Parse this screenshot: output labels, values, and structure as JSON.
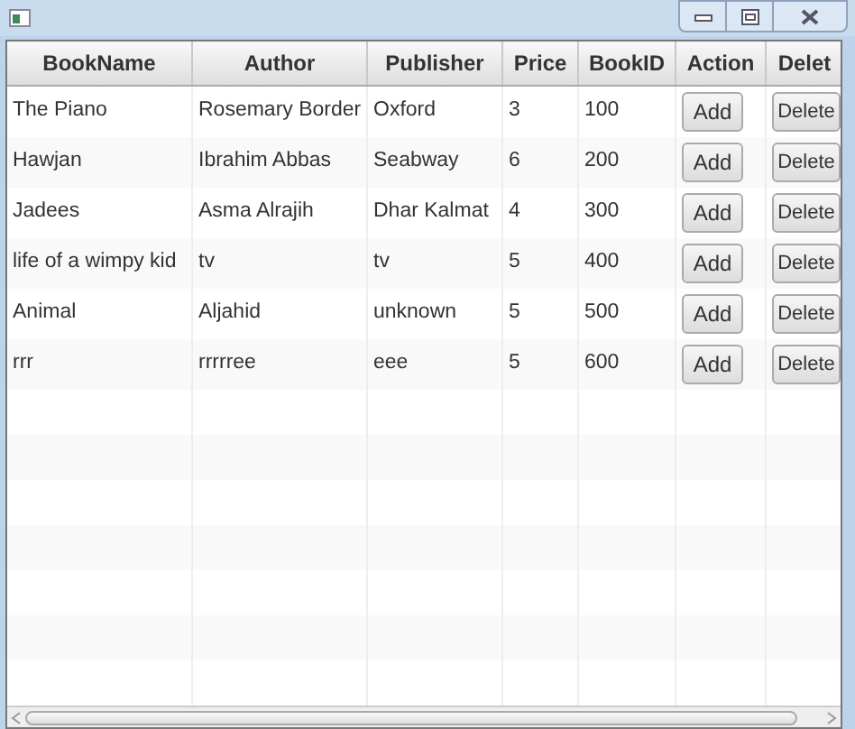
{
  "table": {
    "columns": [
      "BookName",
      "Author",
      "Publisher",
      "Price",
      "BookID",
      "Action",
      "Delet"
    ],
    "rows": [
      {
        "cells": [
          "The Piano",
          "Rosemary Border",
          "Oxford",
          "3",
          "100"
        ],
        "action": "Add",
        "delete": "Delete"
      },
      {
        "cells": [
          "Hawjan",
          "Ibrahim Abbas",
          "Seabway",
          "6",
          "200"
        ],
        "action": "Add",
        "delete": "Delete"
      },
      {
        "cells": [
          "Jadees",
          "Asma Alrajih",
          "Dhar Kalmat",
          "4",
          "300"
        ],
        "action": "Add",
        "delete": "Delete"
      },
      {
        "cells": [
          "life of a wimpy kid",
          "tv",
          "tv",
          "5",
          "400"
        ],
        "action": "Add",
        "delete": "Delete"
      },
      {
        "cells": [
          "Animal",
          "Aljahid",
          "unknown",
          "5",
          "500"
        ],
        "action": "Add",
        "delete": "Delete"
      },
      {
        "cells": [
          "rrr",
          "rrrrree",
          "eee",
          "5",
          "600"
        ],
        "action": "Add",
        "delete": "Delete"
      }
    ]
  }
}
